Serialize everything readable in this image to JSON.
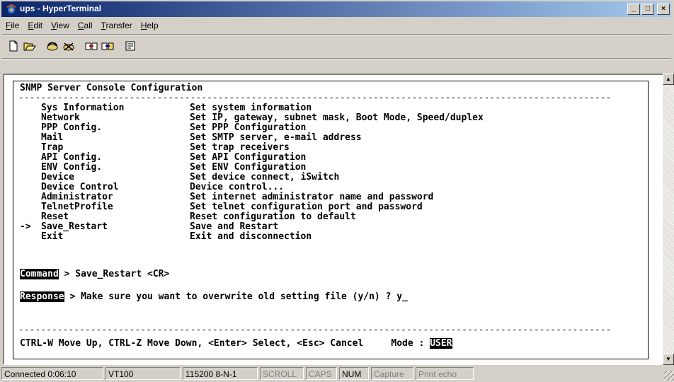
{
  "window": {
    "title": "ups - HyperTerminal",
    "min_glyph": "_",
    "max_glyph": "□",
    "close_glyph": "×"
  },
  "menu": [
    {
      "label": "File",
      "accel": "F",
      "rest": "ile"
    },
    {
      "label": "Edit",
      "accel": "E",
      "rest": "dit"
    },
    {
      "label": "View",
      "accel": "V",
      "rest": "iew"
    },
    {
      "label": "Call",
      "accel": "C",
      "rest": "all"
    },
    {
      "label": "Transfer",
      "accel": "T",
      "rest": "ransfer"
    },
    {
      "label": "Help",
      "accel": "H",
      "rest": "elp"
    }
  ],
  "toolbar": [
    "new-icon",
    "open-icon",
    "connect-icon",
    "disconnect-icon",
    "send-icon",
    "receive-icon",
    "properties-icon"
  ],
  "terminal": {
    "header": "SNMP Server Console Configuration",
    "dashes": "-----------------------------------------------------------------------------------------------------------",
    "menu_items": [
      {
        "marker": "",
        "name": "Sys Information",
        "desc": "Set system information"
      },
      {
        "marker": "",
        "name": "Network",
        "desc": "Set IP, gateway, subnet mask, Boot Mode, Speed/duplex"
      },
      {
        "marker": "",
        "name": "PPP Config.",
        "desc": "Set PPP Configuration"
      },
      {
        "marker": "",
        "name": "Mail",
        "desc": "Set SMTP server, e-mail address"
      },
      {
        "marker": "",
        "name": "Trap",
        "desc": "Set trap receivers"
      },
      {
        "marker": "",
        "name": "API Config.",
        "desc": "Set API Configuration"
      },
      {
        "marker": "",
        "name": "ENV Config.",
        "desc": "Set ENV Configuration"
      },
      {
        "marker": "",
        "name": "Device",
        "desc": "Set device connect, iSwitch"
      },
      {
        "marker": "",
        "name": "Device Control",
        "desc": "Device control..."
      },
      {
        "marker": "",
        "name": "Administrator",
        "desc": "Set internet administrator name and password"
      },
      {
        "marker": "",
        "name": "TelnetProfile",
        "desc": "Set telnet configuration port and password"
      },
      {
        "marker": "",
        "name": "Reset",
        "desc": "Reset configuration to default"
      },
      {
        "marker": "->",
        "name": "Save_Restart",
        "desc": "Save and Restart"
      },
      {
        "marker": "",
        "name": "Exit",
        "desc": "Exit and disconnection"
      }
    ],
    "command_label": "Command",
    "command_text": " > Save_Restart <CR>",
    "response_label": "Response",
    "response_text": " > Make sure you want to overwrite old setting file (y/n) ? y",
    "cursor": "_",
    "footer": "CTRL-W Move Up, CTRL-Z Move Down, <Enter> Select, <Esc> Cancel     Mode : ",
    "mode_badge": "USER"
  },
  "status": {
    "connected": "Connected 0:06:10",
    "emulation": "VT100",
    "port": "115200 8-N-1",
    "scroll": "SCROLL",
    "caps": "CAPS",
    "num": "NUM",
    "capture": "Capture",
    "print_echo": "Print echo"
  }
}
